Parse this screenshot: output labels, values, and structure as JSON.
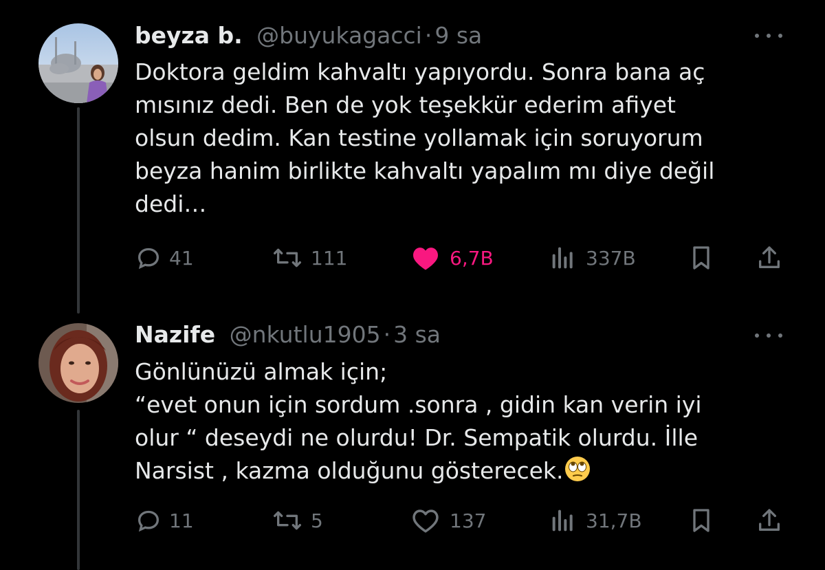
{
  "tweets": [
    {
      "name": "beyza b.",
      "handle": "@buyukagacci",
      "sep": "·",
      "time": "9 sa",
      "lines": [
        "Doktora geldim kahvaltı yapıyordu. Sonra bana aç",
        "mısınız dedi. Ben de yok teşekkür ederim afiyet",
        "olsun dedim. Kan testine yollamak için soruyorum",
        "beyza hanim birlikte kahvaltı yapalım mı diye değil",
        "dedi…"
      ],
      "replies": "41",
      "retweets": "111",
      "likes": "6,7B",
      "liked": true,
      "views": "337B"
    },
    {
      "name": "Nazife",
      "handle": "@nkutlu1905",
      "sep": "·",
      "time": "3 sa",
      "lines": [
        "Gönlünüzü almak için;",
        "“evet onun için sordum .sonra , gidin kan verin iyi",
        "olur “ deseydi ne olurdu! Dr. Sempatik olurdu. İlle",
        "Narsist , kazma olduğunu gösterecek."
      ],
      "emoji": "face-with-rolling-eyes",
      "replies": "11",
      "retweets": "5",
      "likes": "137",
      "liked": false,
      "views": "31,7B"
    }
  ],
  "colors": {
    "background": "#000000",
    "text": "#e7e9ea",
    "secondary": "#71767b",
    "like": "#f91880",
    "thread": "#333639"
  },
  "icons": [
    "reply-icon",
    "retweet-icon",
    "like-icon",
    "views-icon",
    "bookmark-icon",
    "share-icon",
    "more-icon"
  ]
}
